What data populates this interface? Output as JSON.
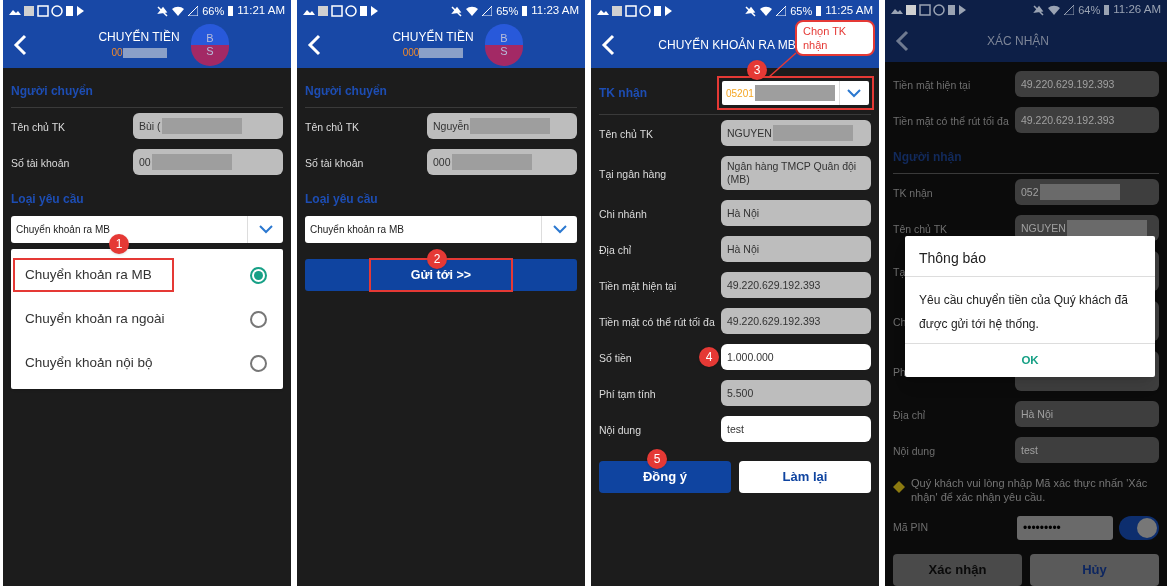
{
  "screens": [
    {
      "dimmed": false,
      "status_bar": {
        "battery": "66%",
        "time": "11:21 AM"
      },
      "header": {
        "title": "CHUYỂN TIỀN",
        "subtitle": "00",
        "bubble": [
          "B",
          "S"
        ]
      },
      "items": [
        {
          "kind": "section",
          "label": "Người chuyển"
        },
        {
          "kind": "field",
          "label": "Tên chủ TK",
          "value": "Bùi (",
          "editable": false,
          "redacted": true
        },
        {
          "kind": "field",
          "label": "Số tài khoản",
          "value": "00",
          "editable": false,
          "redacted": true
        },
        {
          "kind": "section_plain",
          "label": "Loại yêu cầu"
        },
        {
          "kind": "select",
          "value": "Chuyển khoản ra MB",
          "marker": "1"
        },
        {
          "kind": "menu",
          "options": [
            {
              "label": "Chuyển khoản ra MB",
              "selected": true,
              "highlighted": true
            },
            {
              "label": "Chuyển khoản ra ngoài",
              "selected": false,
              "highlighted": false
            },
            {
              "label": "Chuyển khoản nội bộ",
              "selected": false,
              "highlighted": false
            }
          ]
        }
      ]
    },
    {
      "dimmed": false,
      "status_bar": {
        "battery": "65%",
        "time": "11:23 AM"
      },
      "header": {
        "title": "CHUYỂN TIỀN",
        "subtitle": "000",
        "bubble": [
          "B",
          "S"
        ]
      },
      "items": [
        {
          "kind": "section",
          "label": "Người chuyển"
        },
        {
          "kind": "field",
          "label": "Tên chủ TK",
          "value": "Nguyễn",
          "editable": false,
          "redacted": true
        },
        {
          "kind": "field",
          "label": "Số tài khoản",
          "value": "000",
          "editable": false,
          "redacted": true
        },
        {
          "kind": "section_plain",
          "label": "Loại yêu cầu"
        },
        {
          "kind": "select",
          "value": "Chuyển khoản ra MB"
        },
        {
          "kind": "button",
          "label": "Gửi tới >>",
          "marker": "2",
          "highlighted": true
        }
      ]
    },
    {
      "dimmed": false,
      "status_bar": {
        "battery": "65%",
        "time": "11:25 AM"
      },
      "header": {
        "title": "CHUYỂN KHOẢN RA MB"
      },
      "items": [
        {
          "kind": "select_row",
          "label": "TK nhận",
          "value": "05201",
          "redacted": true,
          "marker": "3",
          "highlighted": true,
          "callout": "Chọn TK nhận"
        },
        {
          "kind": "field",
          "label": "Tên chủ TK",
          "value": "NGUYEN",
          "editable": false,
          "redacted": true
        },
        {
          "kind": "field",
          "label": "Tại ngân hàng",
          "value": "Ngân hàng TMCP Quân đội (MB)",
          "editable": false,
          "redacted": false
        },
        {
          "kind": "field",
          "label": "Chi nhánh",
          "value": "Hà Nội",
          "editable": false,
          "redacted": false
        },
        {
          "kind": "field",
          "label": "Địa chỉ",
          "value": "Hà Nội",
          "editable": false,
          "redacted": false
        },
        {
          "kind": "field",
          "label": "Tiền mặt hiện tại",
          "value": "49.220.629.192.393",
          "editable": false,
          "redacted": false
        },
        {
          "kind": "field",
          "label": "Tiền mặt có thể rút tối đa",
          "value": "49.220.629.192.393",
          "editable": false,
          "redacted": false
        },
        {
          "kind": "field",
          "label": "Số tiền",
          "value": "1.000.000",
          "editable": true,
          "redacted": false,
          "marker": "4"
        },
        {
          "kind": "field",
          "label": "Phí tạm tính",
          "value": "5.500",
          "editable": false,
          "redacted": false
        },
        {
          "kind": "field",
          "label": "Nội dung",
          "value": "test",
          "editable": true,
          "redacted": false
        },
        {
          "kind": "buttons",
          "buttons": [
            {
              "label": "Đồng ý",
              "kind": "primary",
              "disabled": false,
              "marker": "5"
            },
            {
              "label": "Làm lại",
              "kind": "secondary",
              "disabled": false
            }
          ]
        }
      ]
    },
    {
      "dimmed": true,
      "status_bar": {
        "battery": "64%",
        "time": "11:26 AM"
      },
      "header": {
        "title": "XÁC NHẬN"
      },
      "items": [
        {
          "kind": "field",
          "label": "Tiền mặt hiện tại",
          "value": "49.220.629.192.393",
          "editable": false,
          "redacted": false
        },
        {
          "kind": "field",
          "label": "Tiền mặt có thể rút tối đa",
          "value": "49.220.629.192.393",
          "editable": false,
          "redacted": false
        },
        {
          "kind": "section",
          "label": "Người nhận"
        },
        {
          "kind": "field",
          "label": "TK nhận",
          "value": "052",
          "editable": false,
          "redacted": true
        },
        {
          "kind": "field",
          "label": "Tên chủ TK",
          "value": "NGUYEN",
          "editable": false,
          "redacted": true
        },
        {
          "kind": "field",
          "label": "Tạ",
          "editable": false,
          "redacted": false
        },
        {
          "kind": "field",
          "label": "Ch",
          "editable": false,
          "redacted": false
        },
        {
          "kind": "field",
          "label": "Ph",
          "editable": false,
          "redacted": false
        },
        {
          "kind": "field",
          "label": "Địa chỉ",
          "value": "Hà Nội",
          "editable": false,
          "redacted": false
        },
        {
          "kind": "field",
          "label": "Nội dung",
          "value": "test",
          "editable": false,
          "redacted": false
        },
        {
          "kind": "notice",
          "text": "Quý khách vui lòng nhập Mã xác thực nhấn 'Xác nhận' để xác nhận yêu cầu."
        },
        {
          "kind": "pin",
          "label": "Mã PIN",
          "value": "•••••••••",
          "on": true
        },
        {
          "kind": "buttons",
          "buttons": [
            {
              "label": "Xác nhận",
              "kind": "primary",
              "disabled": true
            },
            {
              "label": "Hủy",
              "kind": "secondary",
              "disabled": false
            }
          ]
        }
      ],
      "dialog": {
        "title": "Thông báo",
        "message": "Yêu cầu chuyển tiền của Quý khách đã được gửi tới hệ thống.",
        "button": "OK"
      }
    }
  ]
}
